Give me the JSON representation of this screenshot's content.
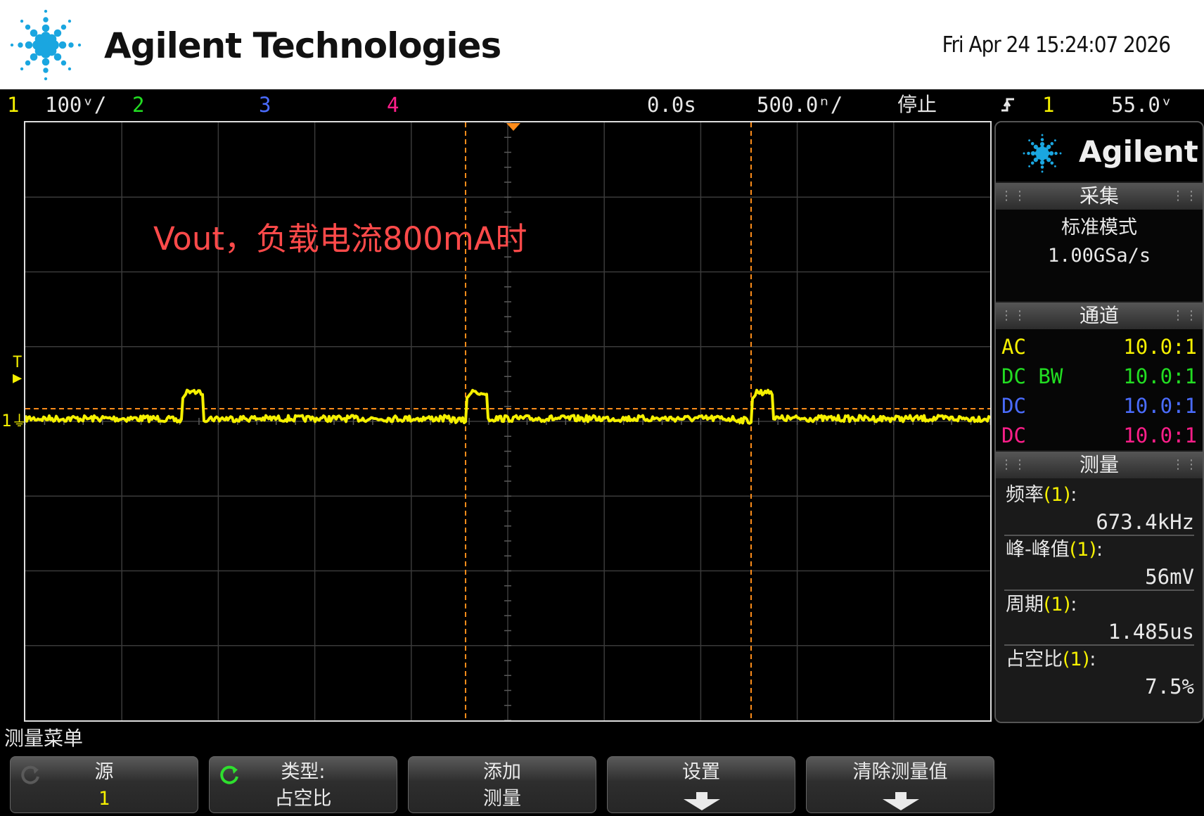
{
  "header": {
    "brand": "Agilent Technologies",
    "datetime": "Fri Apr 24 15:24:07 2026"
  },
  "statusbar": {
    "ch1_num": "1",
    "ch1_scale": "100ᵛ/",
    "ch2_num": "2",
    "ch3_num": "3",
    "ch4_num": "4",
    "time_delay": "0.0s",
    "time_scale": "500.0ⁿ/",
    "run_state": "停止",
    "trigger_source": "1",
    "trigger_level": "55.0ᵛ"
  },
  "screen": {
    "annotation": "Vout，负载电流800mA时",
    "ch1_marker": "1",
    "trigger_marker": "T"
  },
  "panel": {
    "logo": "Agilent",
    "acquire": {
      "title": "采集",
      "mode": "标准模式",
      "rate": "1.00GSa/s"
    },
    "channels": {
      "title": "通道",
      "rows": [
        {
          "coupling": "AC",
          "probe": "10.0:1",
          "color": "#f5f000"
        },
        {
          "coupling": "DC BW",
          "probe": "10.0:1",
          "color": "#22dd22"
        },
        {
          "coupling": "DC",
          "probe": "10.0:1",
          "color": "#4a6cff"
        },
        {
          "coupling": "DC",
          "probe": "10.0:1",
          "color": "#ff1e8a"
        }
      ]
    },
    "measure": {
      "title": "测量",
      "items": [
        {
          "label": "频率",
          "src": "(1)",
          "colon": ":",
          "value": "673.4kHz"
        },
        {
          "label": "峰-峰值",
          "src": "(1)",
          "colon": ":",
          "value": "56mV"
        },
        {
          "label": "周期",
          "src": "(1)",
          "colon": ":",
          "value": "1.485us"
        },
        {
          "label": "占空比",
          "src": "(1)",
          "colon": ":",
          "value": "7.5%"
        }
      ]
    }
  },
  "softkeys": {
    "menu_title": "测量菜单",
    "keys": [
      {
        "line1": "源",
        "line2": "1"
      },
      {
        "line1": "类型:",
        "line2": "占空比"
      },
      {
        "line1": "添加",
        "line2": "测量"
      },
      {
        "line1": "设置",
        "line2": ""
      },
      {
        "line1": "清除测量值",
        "line2": ""
      }
    ]
  },
  "colors": {
    "ch1": "#f5f000",
    "ch2": "#22dd22",
    "ch3": "#4a6cff",
    "ch4": "#ff1e8a",
    "cursor": "#ff8c1a",
    "annotation": "#ff4a4a"
  }
}
